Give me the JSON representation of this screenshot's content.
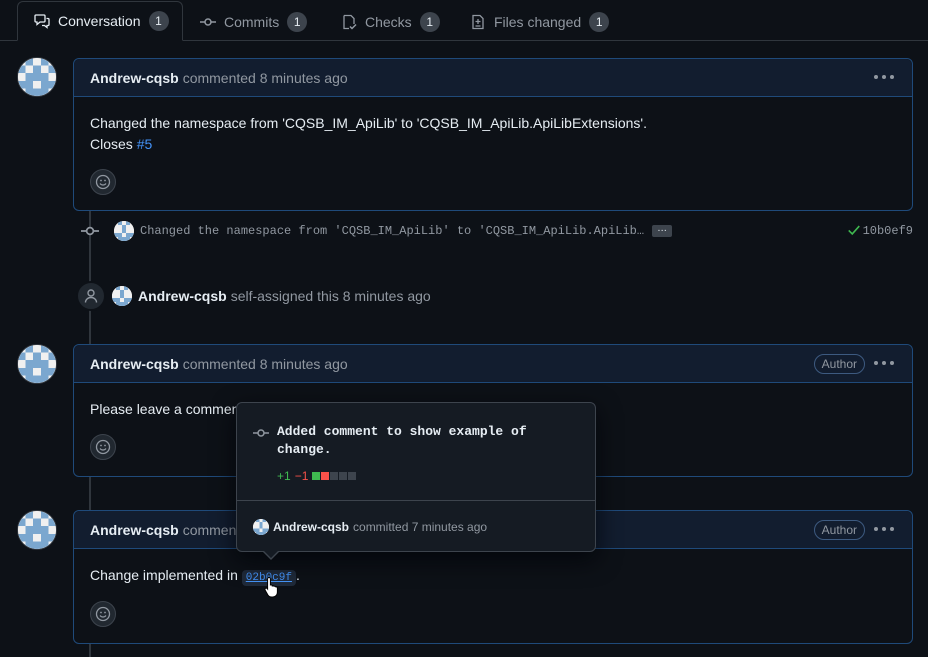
{
  "tabs": [
    {
      "label": "Conversation",
      "count": "1",
      "icon": "comment-discussion-icon"
    },
    {
      "label": "Commits",
      "count": "1",
      "icon": "git-commit-icon"
    },
    {
      "label": "Checks",
      "count": "1",
      "icon": "checklist-icon"
    },
    {
      "label": "Files changed",
      "count": "1",
      "icon": "file-diff-icon"
    }
  ],
  "comment1": {
    "author": "Andrew-cqsb",
    "meta": "commented 8 minutes ago",
    "body_line1": "Changed the namespace from 'CQSB_IM_ApiLib' to 'CQSB_IM_ApiLib.ApiLibExtensions'.",
    "closes_text": "Closes",
    "closes_link": "#5"
  },
  "commit_event": {
    "message": "Changed the namespace from 'CQSB_IM_ApiLib' to 'CQSB_IM_ApiLib.ApiLib…",
    "ellipsis": "…",
    "sha": "10b0ef9",
    "status": "success"
  },
  "assign_event": {
    "author": "Andrew-cqsb",
    "text": "self-assigned this 8 minutes ago"
  },
  "comment2": {
    "author": "Andrew-cqsb",
    "meta": "commented 8 minutes ago",
    "badge": "Author",
    "body": "Please leave a comment"
  },
  "comment3": {
    "author": "Andrew-cqsb",
    "meta": "comment",
    "badge": "Author",
    "body_prefix": "Change implemented in",
    "sha_link": "02b0c9f",
    "body_suffix": "."
  },
  "popover": {
    "title": "Added comment to show example of change.",
    "additions": "+1",
    "deletions": "−1",
    "author": "Andrew-cqsb",
    "meta": "committed 7 minutes ago"
  },
  "colors": {
    "accent": "#4493f8",
    "success": "#3fb950",
    "danger": "#f85149",
    "bg": "#0d1117"
  }
}
